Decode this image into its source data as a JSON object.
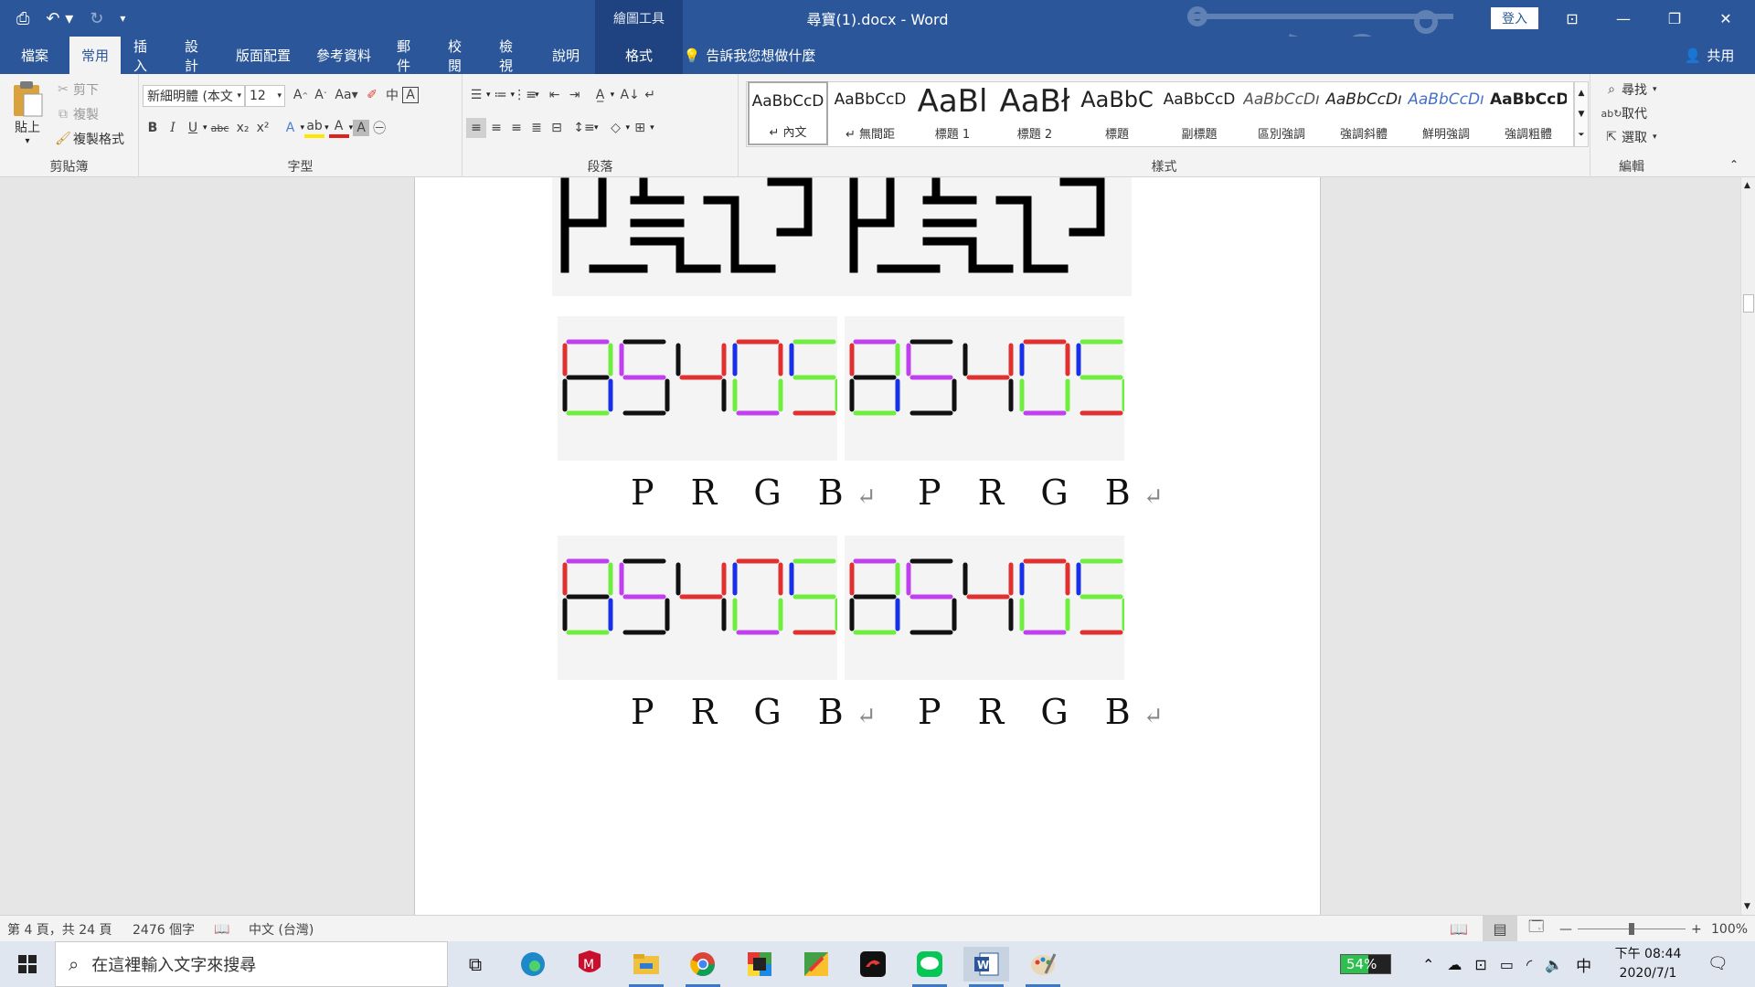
{
  "titlebar": {
    "title": "尋寶(1).docx  -  Word",
    "context_group": "繪圖工具",
    "login": "登入"
  },
  "tabs": [
    "檔案",
    "常用",
    "插入",
    "設計",
    "版面配置",
    "參考資料",
    "郵件",
    "校閱",
    "檢視",
    "說明",
    "格式"
  ],
  "tellme": "告訴我您想做什麼",
  "share": "共用",
  "clipboard": {
    "paste": "貼上",
    "cut": "剪下",
    "copy": "複製",
    "format_painter": "複製格式",
    "label": "剪貼簿"
  },
  "font": {
    "name": "新細明體 (本文",
    "size": "12",
    "label": "字型",
    "change_case": "Aa"
  },
  "paragraph": {
    "label": "段落"
  },
  "styles": {
    "label": "樣式",
    "items": [
      {
        "preview": "AaBbCcD",
        "name": "↵ 內文"
      },
      {
        "preview": "AaBbCcD",
        "name": "↵ 無間距"
      },
      {
        "preview": "AaBl",
        "name": "標題 1"
      },
      {
        "preview": "AaBł",
        "name": "標題 2"
      },
      {
        "preview": "AaBbC",
        "name": "標題"
      },
      {
        "preview": "AaBbCcD",
        "name": "副標題"
      },
      {
        "preview": "AaBbCcDı",
        "name": "區別強調"
      },
      {
        "preview": "AaBbCcDı",
        "name": "強調斜體"
      },
      {
        "preview": "AaBbCcDı",
        "name": "鮮明強調"
      },
      {
        "preview": "AaBbCcD",
        "name": "強調粗體"
      }
    ]
  },
  "editing": {
    "find": "尋找",
    "replace": "取代",
    "select": "選取",
    "label": "編輯"
  },
  "document": {
    "captions": [
      "P R G B",
      "P R G B",
      "P R G B",
      "P R G B"
    ],
    "digits": "85405"
  },
  "status": {
    "page": "第 4 頁，共 24 頁",
    "words": "2476 個字",
    "language": "中文 (台灣)",
    "zoom": "100%"
  },
  "taskbar": {
    "search_placeholder": "在這裡輸入文字來搜尋",
    "battery": "54%",
    "ime": "中",
    "time": "下午 08:44",
    "date": "2020/7/1"
  }
}
